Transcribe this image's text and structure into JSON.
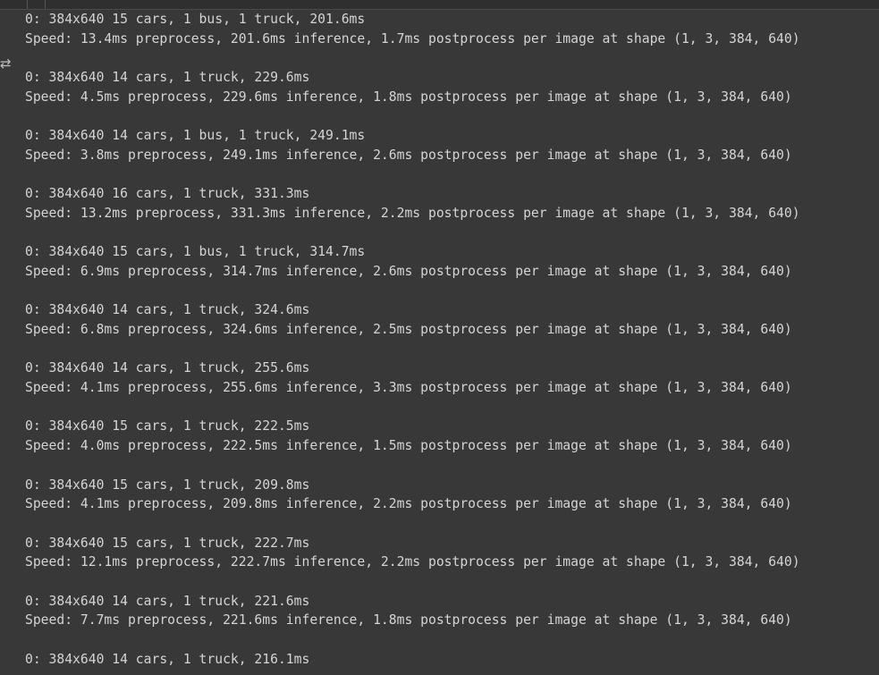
{
  "output": {
    "lines": [
      "0: 384x640 15 cars, 1 bus, 1 truck, 201.6ms",
      "Speed: 13.4ms preprocess, 201.6ms inference, 1.7ms postprocess per image at shape (1, 3, 384, 640)",
      "",
      "0: 384x640 14 cars, 1 truck, 229.6ms",
      "Speed: 4.5ms preprocess, 229.6ms inference, 1.8ms postprocess per image at shape (1, 3, 384, 640)",
      "",
      "0: 384x640 14 cars, 1 bus, 1 truck, 249.1ms",
      "Speed: 3.8ms preprocess, 249.1ms inference, 2.6ms postprocess per image at shape (1, 3, 384, 640)",
      "",
      "0: 384x640 16 cars, 1 truck, 331.3ms",
      "Speed: 13.2ms preprocess, 331.3ms inference, 2.2ms postprocess per image at shape (1, 3, 384, 640)",
      "",
      "0: 384x640 15 cars, 1 bus, 1 truck, 314.7ms",
      "Speed: 6.9ms preprocess, 314.7ms inference, 2.6ms postprocess per image at shape (1, 3, 384, 640)",
      "",
      "0: 384x640 14 cars, 1 truck, 324.6ms",
      "Speed: 6.8ms preprocess, 324.6ms inference, 2.5ms postprocess per image at shape (1, 3, 384, 640)",
      "",
      "0: 384x640 14 cars, 1 truck, 255.6ms",
      "Speed: 4.1ms preprocess, 255.6ms inference, 3.3ms postprocess per image at shape (1, 3, 384, 640)",
      "",
      "0: 384x640 15 cars, 1 truck, 222.5ms",
      "Speed: 4.0ms preprocess, 222.5ms inference, 1.5ms postprocess per image at shape (1, 3, 384, 640)",
      "",
      "0: 384x640 15 cars, 1 truck, 209.8ms",
      "Speed: 4.1ms preprocess, 209.8ms inference, 2.2ms postprocess per image at shape (1, 3, 384, 640)",
      "",
      "0: 384x640 15 cars, 1 truck, 222.7ms",
      "Speed: 12.1ms preprocess, 222.7ms inference, 2.2ms postprocess per image at shape (1, 3, 384, 640)",
      "",
      "0: 384x640 14 cars, 1 truck, 221.6ms",
      "Speed: 7.7ms preprocess, 221.6ms inference, 1.8ms postprocess per image at shape (1, 3, 384, 640)",
      "",
      "0: 384x640 14 cars, 1 truck, 216.1ms"
    ]
  },
  "icons": {
    "output_menu": "output-actions-icon"
  },
  "colors": {
    "background": "#383838",
    "text": "#d4d4d4"
  }
}
